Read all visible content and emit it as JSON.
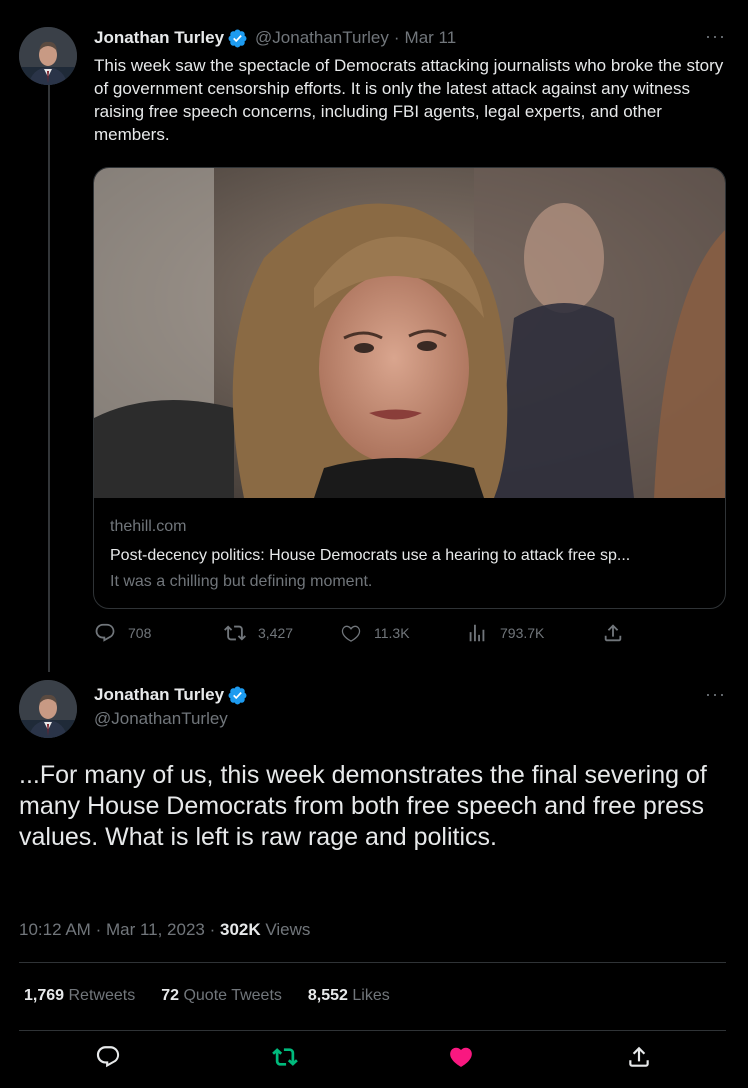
{
  "tweet1": {
    "author_name": "Jonathan Turley",
    "handle": "@JonathanTurley",
    "separator": "·",
    "date": "Mar 11",
    "more": "···",
    "text": "This week saw the spectacle of Democrats attacking journalists who broke the story of government censorship efforts. It is only the latest attack against any witness raising free speech concerns, including FBI agents, legal experts, and other members.",
    "card": {
      "domain": "thehill.com",
      "title": "Post-decency politics: House Democrats use a hearing to attack free sp...",
      "description": "It was a chilling but defining moment."
    },
    "actions": {
      "replies": "708",
      "retweets": "3,427",
      "likes": "11.3K",
      "views": "793.7K"
    }
  },
  "tweet2": {
    "author_name": "Jonathan Turley",
    "handle": "@JonathanTurley",
    "more": "···",
    "text": "...For many of us, this week demonstrates the final severing of many House Democrats from both free speech and free press values. What is left is raw rage and politics.",
    "meta": {
      "time": "10:12 AM",
      "date": "Mar 11, 2023",
      "views_count": "302K",
      "views_label": "Views"
    },
    "stats": {
      "retweets_count": "1,769",
      "retweets_label": "Retweets",
      "quotes_count": "72",
      "quotes_label": "Quote Tweets",
      "likes_count": "8,552",
      "likes_label": "Likes"
    }
  },
  "colors": {
    "background": "#000000",
    "text": "#e7e9ea",
    "secondary": "#71767b",
    "border": "#2f3336",
    "verified": "#1d9bf0",
    "retweeted": "#00ba7c",
    "liked": "#f91880"
  },
  "icons": [
    "verified-badge-icon",
    "reply-icon",
    "retweet-icon",
    "like-icon",
    "views-icon",
    "share-icon",
    "more-icon"
  ]
}
